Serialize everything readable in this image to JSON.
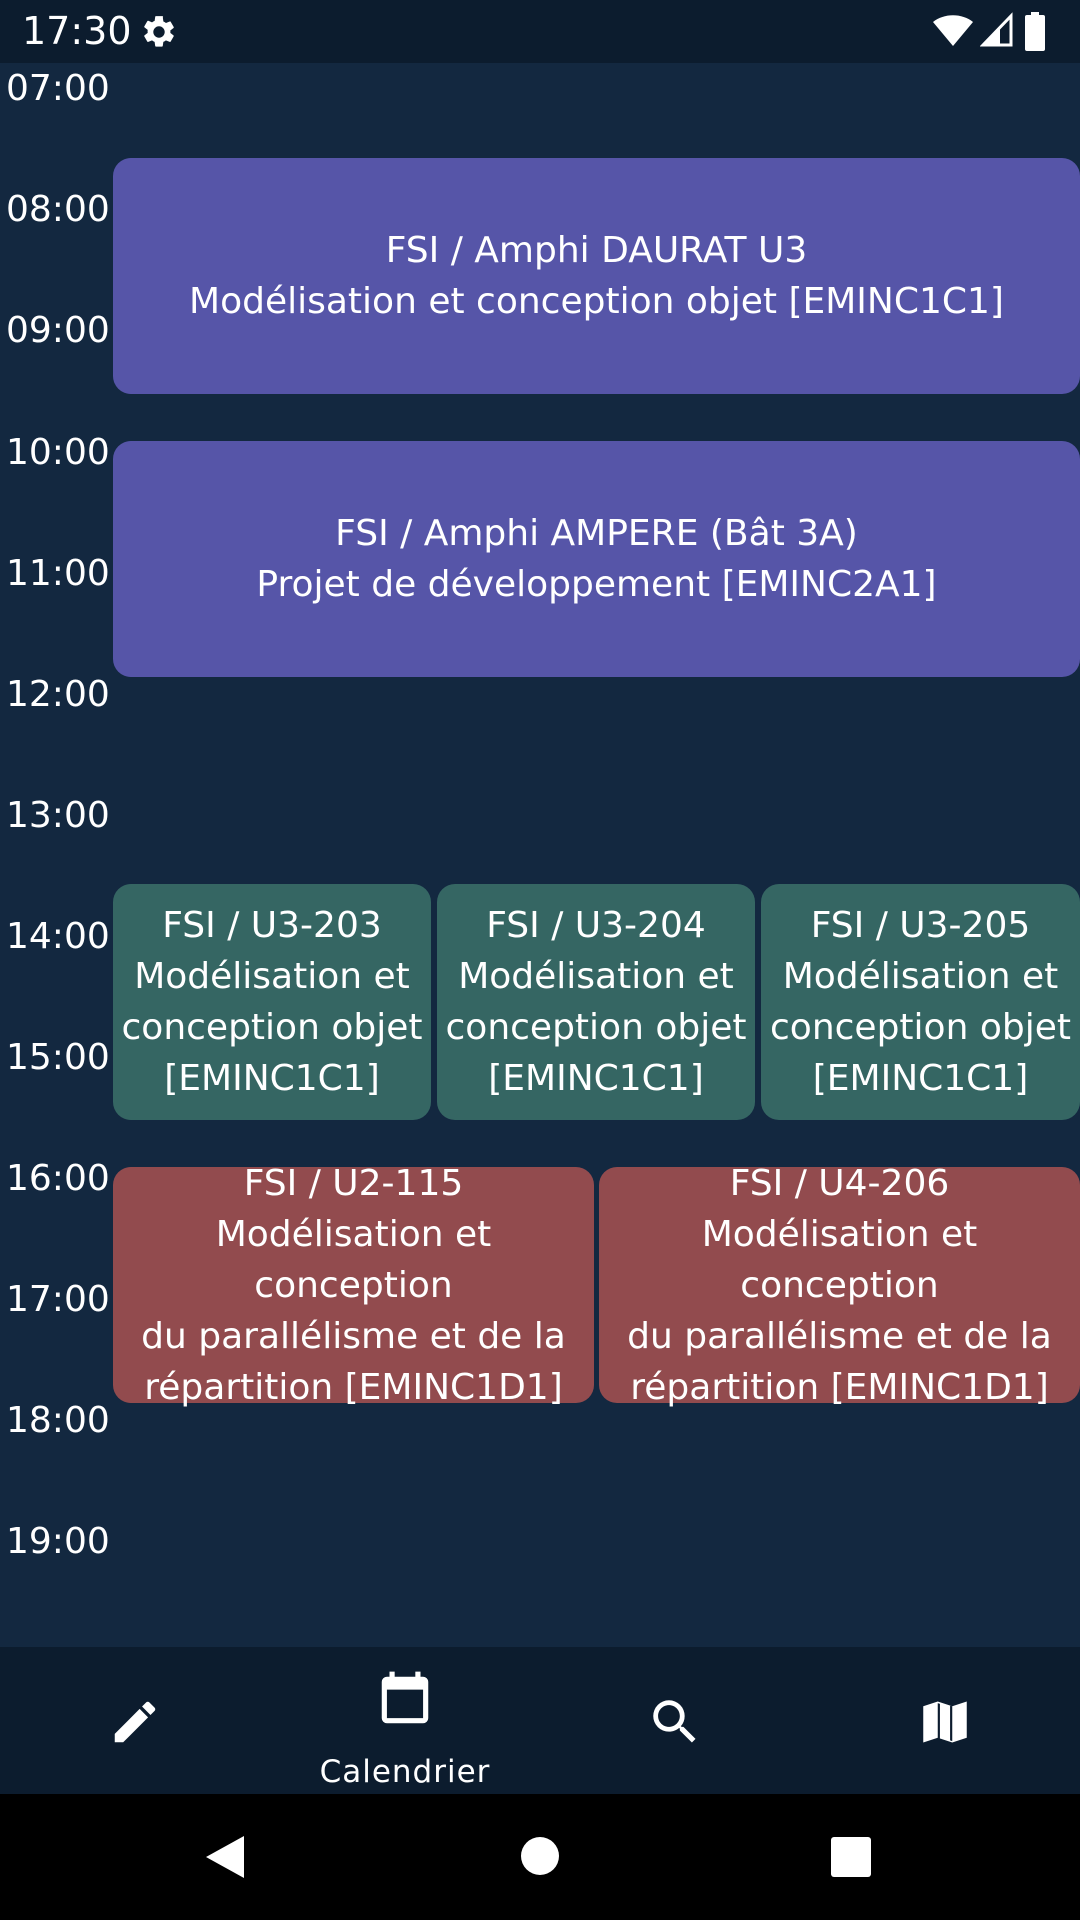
{
  "status_bar": {
    "time": "17:30",
    "icons": [
      "settings-icon",
      "wifi-icon",
      "cellular-signal-icon",
      "battery-icon"
    ]
  },
  "timeline": {
    "hours": [
      "07:00",
      "08:00",
      "09:00",
      "10:00",
      "11:00",
      "12:00",
      "13:00",
      "14:00",
      "15:00",
      "16:00",
      "17:00",
      "18:00",
      "19:00"
    ],
    "events": [
      {
        "location": "FSI / Amphi DAURAT U3",
        "course": "Modélisation et conception objet [EMINC1C1]",
        "color": "#5655a8"
      },
      {
        "location": "FSI / Amphi AMPERE (Bât 3A)",
        "course": "Projet de développement [EMINC2A1]",
        "color": "#5655a8"
      },
      {
        "location": "FSI / U3-203",
        "course_lines": [
          "Modélisation et",
          "conception objet",
          "[EMINC1C1]"
        ],
        "color": "#356663"
      },
      {
        "location": "FSI / U3-204",
        "course_lines": [
          "Modélisation et",
          "conception objet",
          "[EMINC1C1]"
        ],
        "color": "#356663"
      },
      {
        "location": "FSI / U3-205",
        "course_lines": [
          "Modélisation et",
          "conception objet",
          "[EMINC1C1]"
        ],
        "color": "#356663"
      },
      {
        "location": "FSI / U2-115",
        "course_lines": [
          "Modélisation et conception",
          "du parallélisme et de la",
          "répartition [EMINC1D1]"
        ],
        "color": "#924b4e"
      },
      {
        "location": "FSI / U4-206",
        "course_lines": [
          "Modélisation et conception",
          "du parallélisme et de la",
          "répartition [EMINC1D1]"
        ],
        "color": "#924b4e"
      }
    ]
  },
  "bottom_nav": {
    "items": [
      {
        "icon": "pencil-icon",
        "label": ""
      },
      {
        "icon": "calendar-icon",
        "label": "Calendrier"
      },
      {
        "icon": "search-icon",
        "label": ""
      },
      {
        "icon": "map-icon",
        "label": ""
      }
    ]
  },
  "system_nav": [
    "back-icon",
    "home-icon",
    "recents-icon"
  ]
}
